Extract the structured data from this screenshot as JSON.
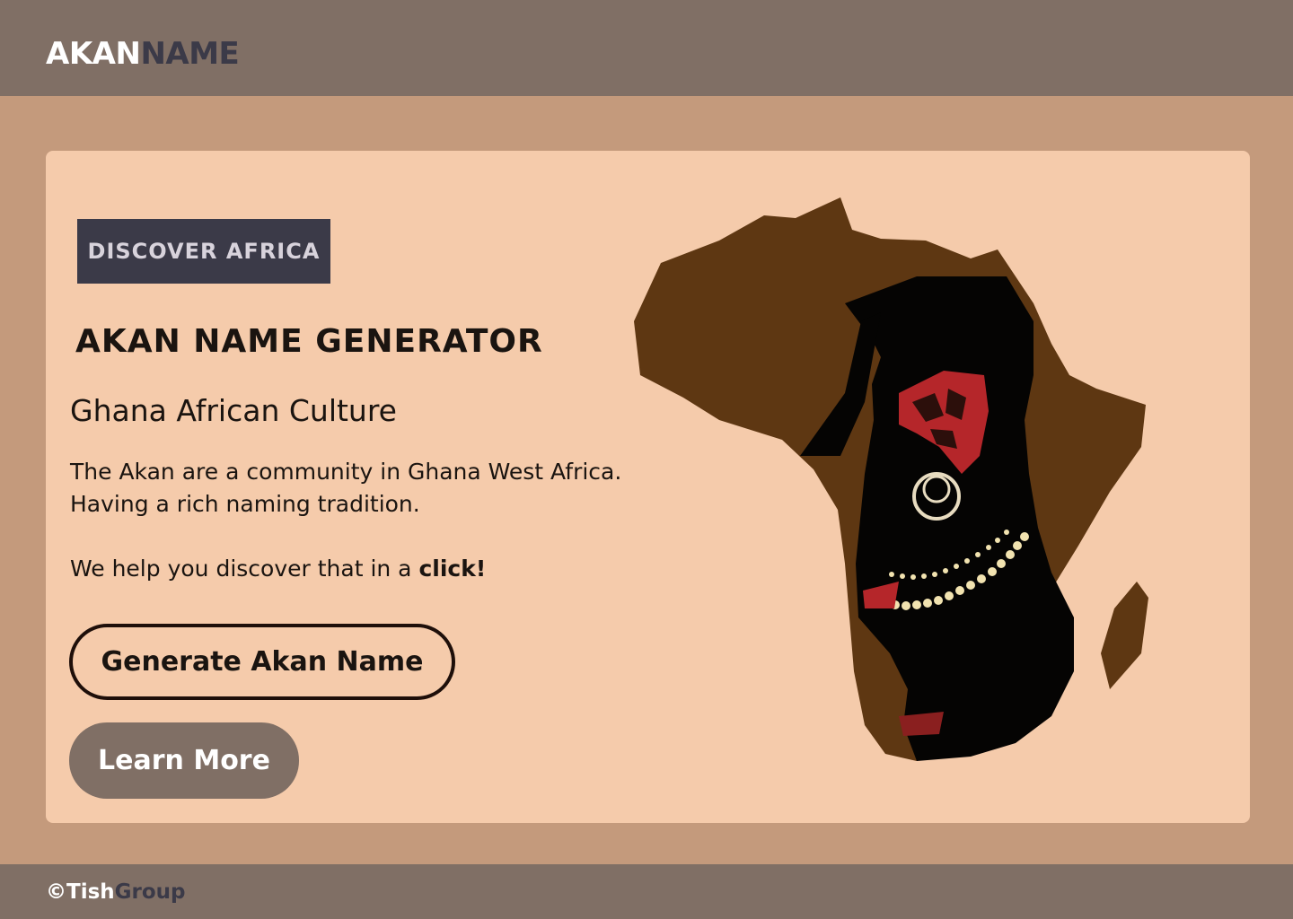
{
  "header": {
    "logo_part1": "AKAN",
    "logo_part2": "NAME"
  },
  "hero": {
    "badge": "DISCOVER AFRICA",
    "title": "AKAN NAME GENERATOR",
    "subtitle": "Ghana African Culture",
    "description_line1": "The Akan are a community in Ghana West Africa.",
    "description_line2": "Having a rich naming tradition.",
    "cta_text": "We help you discover that in a ",
    "cta_emphasis": "click!",
    "primary_button": "Generate Akan Name",
    "secondary_button": "Learn More",
    "image_icon": "africa-map-woman-illustration"
  },
  "footer": {
    "copyright_part1": "©Tish",
    "copyright_part2": "Group"
  },
  "colors": {
    "header_bg": "#806f65",
    "page_bg": "#c49a7c",
    "card_bg": "#f5cbab",
    "badge_bg": "#3b3a48",
    "map_brown": "#5e3712",
    "accent_red": "#b5262a"
  }
}
